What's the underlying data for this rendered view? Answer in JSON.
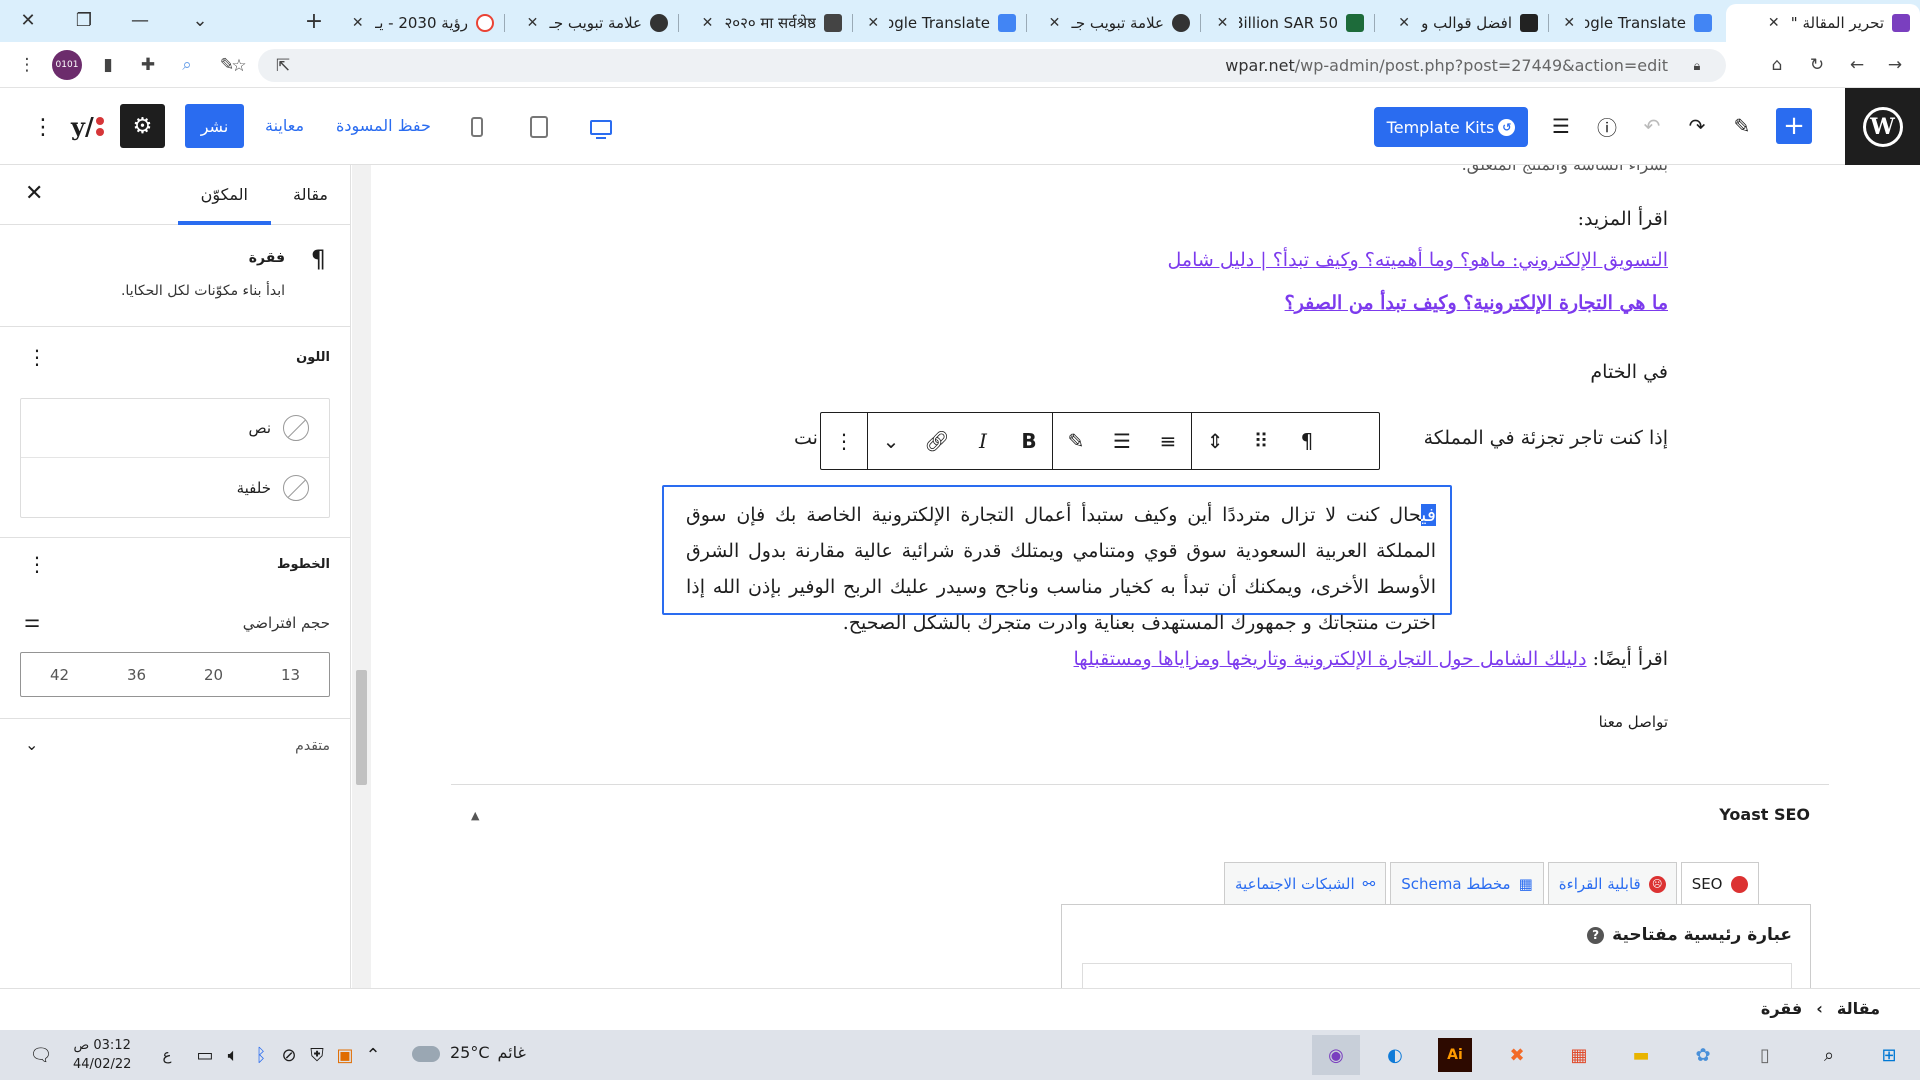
{
  "browser": {
    "tabs": [
      {
        "title": "تحرير المقالة \"",
        "favicon_color": "#7a3fbf",
        "active": true
      },
      {
        "title": "Google Translate",
        "favicon_color": "#4285f4",
        "active": false
      },
      {
        "title": "افضل قوالب و",
        "favicon_color": "#222222",
        "active": false
      },
      {
        "title": "50 Billion SAR",
        "favicon_color": "#1d6b3a",
        "active": false
      },
      {
        "title": "علامة تبويب جـ",
        "favicon_color": "#333333",
        "active": false
      },
      {
        "title": "Google Translate",
        "favicon_color": "#4285f4",
        "active": false
      },
      {
        "title": "२०२० मा सर्वश्रेष्ठ",
        "favicon_color": "#444444",
        "active": false
      },
      {
        "title": "علامة تبويب جـ",
        "favicon_color": "#333333",
        "active": false
      },
      {
        "title": "رؤية 2030 - يـ",
        "favicon_color": "#ea4335",
        "active": false
      }
    ],
    "url_host": "wpar.net",
    "url_path": "/wp-admin/post.php?post=27449&action=edit"
  },
  "wp_header": {
    "template_kits_label": "Template Kits",
    "save_draft_label": "حفظ المسودة",
    "preview_label": "معاينة",
    "publish_label": "نشر"
  },
  "sidebar": {
    "tab_post": "مقالة",
    "tab_block": "المكوّن",
    "block_title": "فقرة",
    "block_description": "ابدأ بناء مكوّنات لكل الحكايا.",
    "color_title": "اللون",
    "color_text": "نص",
    "color_background": "خلفية",
    "typography_title": "الخطوط",
    "font_size_label": "حجم افتراضي",
    "font_sizes": [
      "13",
      "20",
      "36",
      "42"
    ],
    "advanced_label": "متقدم"
  },
  "content": {
    "partial_top": "بشراء الشاشة والمنتج المتعلق.",
    "read_more": "اقرأ المزيد:",
    "link1": "التسويق الإلكتروني: ماهو؟ وما أهميته؟ وكيف تبدأ؟ | دليل شامل",
    "link2": "ما هي التجارة الإلكترونية؟ وكيف تبدأ من الصفر؟",
    "conclusion_heading": "في الختام",
    "para_partial": "إذا كنت تاجر تجزئة في المملكة",
    "para_partial_end": "نت",
    "sel_highlight": "في",
    "sel_text": "حال كنت لا تزال مترددًا أين وكيف ستبدأ أعمال التجارة الإلكترونية الخاصة بك فإن سوق المملكة العربية السعودية سوق قوي ومتنامي ويمتلك قدرة شرائية عالية مقارنة بدول الشرق الأوسط الأخرى، ويمكنك أن تبدأ به كخيار مناسب وناجح وسيدر عليك الربح الوفير بإذن الله إذا اخترت منتجاتك و جمهورك المستهدف بعناية وادرت متجرك بالشكل الصحيح.",
    "read_also_prefix": "اقرأ أيضًا:",
    "link3": "دليلك الشامل حول التجارة الإلكترونية وتاريخها ومزاياها ومستقبلها",
    "contact": "تواصل معنا"
  },
  "yoast": {
    "title": "Yoast SEO",
    "tab_seo": "SEO",
    "tab_readability": "قابلية القراءة",
    "tab_schema": "مخطط Schema",
    "tab_social": "الشبكات الاجتماعية",
    "keyphrase_label": "عبارة رئيسية مفتاحية"
  },
  "breadcrumb": {
    "item1": "مقالة",
    "separator": "›",
    "item2": "فقرة"
  },
  "taskbar": {
    "time": "03:12 ص",
    "date": "44/02/22",
    "lang": "ع",
    "temperature": "25°C",
    "weather": "غائم"
  },
  "colors": {
    "accent": "#2a6cf0",
    "link": "#7c3aed",
    "tabstrip": "#dbeffc"
  }
}
